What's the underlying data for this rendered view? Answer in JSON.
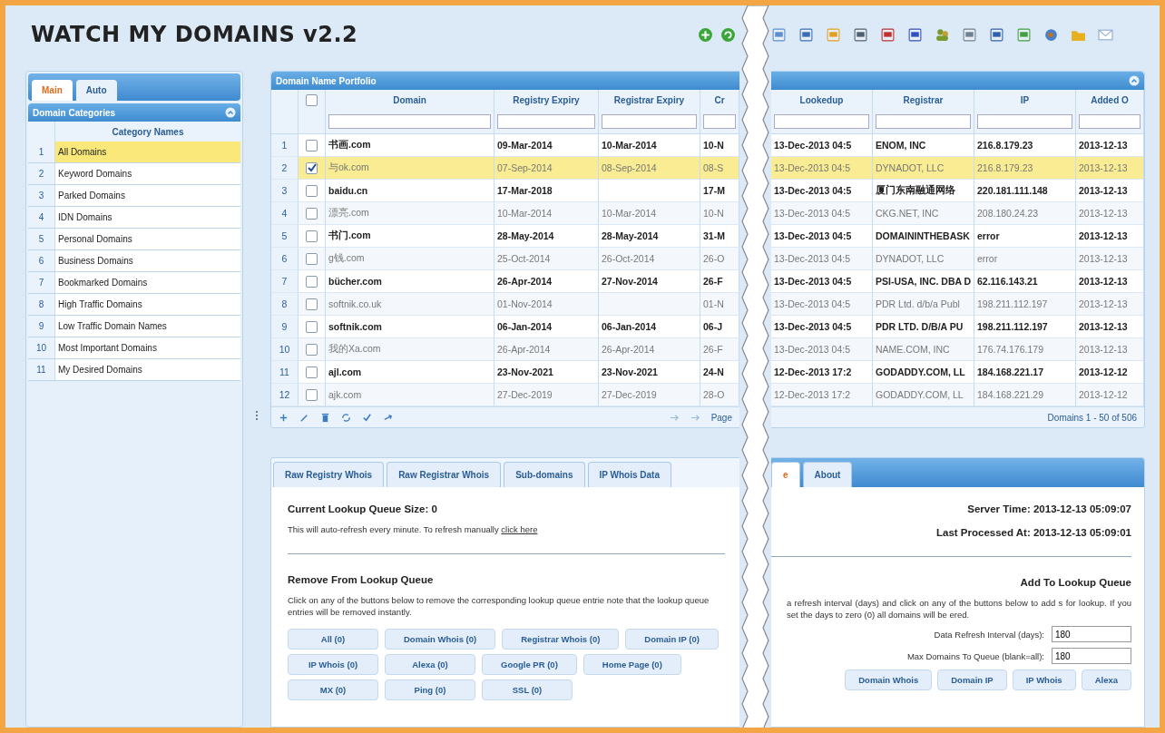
{
  "header": {
    "title": "WATCH MY DOMAINS v2.2"
  },
  "sidebar": {
    "tabs": [
      {
        "label": "Main",
        "selected": true
      },
      {
        "label": "Auto",
        "selected": false
      }
    ],
    "panel_title": "Domain Categories",
    "column": "Category Names",
    "items": [
      {
        "number": "1",
        "label": "All Domains",
        "selected": true
      },
      {
        "number": "2",
        "label": "Keyword Domains",
        "selected": false
      },
      {
        "number": "3",
        "label": "Parked Domains",
        "selected": false
      },
      {
        "number": "4",
        "label": "IDN Domains",
        "selected": false
      },
      {
        "number": "5",
        "label": "Personal Domains",
        "selected": false
      },
      {
        "number": "6",
        "label": "Business Domains",
        "selected": false
      },
      {
        "number": "7",
        "label": "Bookmarked Domains",
        "selected": false
      },
      {
        "number": "8",
        "label": "High Traffic Domains",
        "selected": false
      },
      {
        "number": "9",
        "label": "Low Traffic Domain Names",
        "selected": false
      },
      {
        "number": "10",
        "label": "Most Important Domains",
        "selected": false
      },
      {
        "number": "11",
        "label": "My Desired Domains",
        "selected": false
      }
    ]
  },
  "portfolio": {
    "title": "Domain Name Portfolio",
    "select_all_checked": false,
    "columns": [
      "Domain",
      "Registry Expiry",
      "Registrar Expiry",
      "Cr",
      "Lookedup",
      "Registrar",
      "IP",
      "Added O"
    ],
    "rows": [
      {
        "number": "1",
        "checked": false,
        "selected": false,
        "bold": true,
        "domain": "书画.com",
        "registry_expiry": "09-Mar-2014",
        "registrar_expiry": "10-Mar-2014",
        "column_4": "10-N",
        "lookedup": "13-Dec-2013 04:5",
        "registrar": "ENOM, INC",
        "ip": "216.8.179.23",
        "added": "2013-12-13"
      },
      {
        "number": "2",
        "checked": true,
        "selected": true,
        "bold": false,
        "domain": "与ok.com",
        "registry_expiry": "07-Sep-2014",
        "registrar_expiry": "08-Sep-2014",
        "column_4": "08-S",
        "lookedup": "13-Dec-2013 04:5",
        "registrar": "DYNADOT, LLC",
        "ip": "216.8.179.23",
        "added": "2013-12-13"
      },
      {
        "number": "3",
        "checked": false,
        "selected": false,
        "bold": true,
        "domain": "baidu.cn",
        "registry_expiry": "17-Mar-2018",
        "column_4": "17-M",
        "lookedup": "13-Dec-2013 04:5",
        "registrar": "厦门东南融通网络",
        "ip": "220.181.111.148",
        "added": "2013-12-13"
      },
      {
        "number": "4",
        "checked": false,
        "selected": false,
        "bold": false,
        "domain": "漂亮.com",
        "registry_expiry": "10-Mar-2014",
        "registrar_expiry": "10-Mar-2014",
        "column_4": "10-N",
        "lookedup": "13-Dec-2013 04:5",
        "registrar": "CKG.NET, INC",
        "ip": "208.180.24.23",
        "added": "2013-12-13"
      },
      {
        "number": "5",
        "checked": false,
        "selected": false,
        "bold": true,
        "domain": "书门.com",
        "registry_expiry": "28-May-2014",
        "registrar_expiry": "28-May-2014",
        "column_4": "31-M",
        "lookedup": "13-Dec-2013 04:5",
        "registrar": "DOMAININTHEBASK",
        "ip": "error",
        "added": "2013-12-13"
      },
      {
        "number": "6",
        "checked": false,
        "selected": false,
        "bold": false,
        "domain": "g钱.com",
        "registry_expiry": "25-Oct-2014",
        "registrar_expiry": "26-Oct-2014",
        "column_4": "26-O",
        "lookedup": "13-Dec-2013 04:5",
        "registrar": "DYNADOT, LLC",
        "ip": "error",
        "added": "2013-12-13"
      },
      {
        "number": "7",
        "checked": false,
        "selected": false,
        "bold": true,
        "domain": "bücher.com",
        "registry_expiry": "26-Apr-2014",
        "registrar_expiry": "27-Nov-2014",
        "column_4": "26-F",
        "lookedup": "13-Dec-2013 04:5",
        "registrar": "PSI-USA, INC. DBA D",
        "ip": "62.116.143.21",
        "added": "2013-12-13"
      },
      {
        "number": "8",
        "checked": false,
        "selected": false,
        "bold": false,
        "domain": "softnik.co.uk",
        "registry_expiry": "01-Nov-2014",
        "column_4": "01-N",
        "lookedup": "13-Dec-2013 04:5",
        "registrar": "PDR Ltd. d/b/a Publ",
        "ip": "198.211.112.197",
        "added": "2013-12-13"
      },
      {
        "number": "9",
        "checked": false,
        "selected": false,
        "bold": true,
        "domain": "softnik.com",
        "registry_expiry": "06-Jan-2014",
        "registrar_expiry": "06-Jan-2014",
        "column_4": "06-J",
        "lookedup": "13-Dec-2013 04:5",
        "registrar": "PDR LTD. D/B/A PU",
        "ip": "198.211.112.197",
        "added": "2013-12-13"
      },
      {
        "number": "10",
        "checked": false,
        "selected": false,
        "bold": false,
        "domain": "我的Xa.com",
        "registry_expiry": "26-Apr-2014",
        "registrar_expiry": "26-Apr-2014",
        "column_4": "26-F",
        "lookedup": "13-Dec-2013 04:5",
        "registrar": "NAME.COM, INC",
        "ip": "176.74.176.179",
        "added": "2013-12-13"
      },
      {
        "number": "11",
        "checked": false,
        "selected": false,
        "bold": true,
        "domain": "ajl.com",
        "registry_expiry": "23-Nov-2021",
        "registrar_expiry": "23-Nov-2021",
        "column_4": "24-N",
        "lookedup": "12-Dec-2013 17:2",
        "registrar": "GODADDY.COM, LL",
        "ip": "184.168.221.17",
        "added": "2013-12-12"
      },
      {
        "number": "12",
        "checked": false,
        "selected": false,
        "bold": false,
        "domain": "ajk.com",
        "registry_expiry": "27-Dec-2019",
        "registrar_expiry": "27-Dec-2019",
        "column_4": "28-O",
        "lookedup": "12-Dec-2013 17:2",
        "registrar": "GODADDY.COM, LL",
        "ip": "184.168.221.29",
        "added": "2013-12-12"
      }
    ],
    "pager": "Page",
    "record_info": "Domains 1 - 50 of 506"
  },
  "details": {
    "tabs_left": [
      {
        "label": "Raw Registry Whois",
        "selected": false
      },
      {
        "label": "Raw Registrar Whois",
        "selected": false
      },
      {
        "label": "Sub-domains",
        "selected": false
      },
      {
        "label": "IP Whois Data",
        "selected": false
      }
    ],
    "tabs_right": [
      {
        "label": "e",
        "selected": true
      },
      {
        "label": "About",
        "selected": false
      }
    ],
    "queue_size": "Current Lookup Queue Size: 0",
    "refresh_note": "This will auto-refresh every minute. To refresh manually ",
    "refresh_link": "click here",
    "server_time": "Server Time: 2013-12-13 05:09:07",
    "last_processed": "Last Processed At: 2013-12-13 05:09:01",
    "remove_heading": "Remove From Lookup Queue",
    "remove_note": "Click on any of the buttons below to remove the corresponding lookup queue entrie note that the lookup queue entries will be removed instantly.",
    "remove_buttons": [
      "All (0)",
      "Domain Whois (0)",
      "Registrar Whois (0)",
      "Domain IP (0)",
      "IP Whois (0)",
      "Alexa (0)",
      "Google PR (0)",
      "Home Page (0)",
      "MX (0)",
      "Ping (0)",
      "SSL (0)"
    ],
    "add_heading": "Add To Lookup Queue",
    "add_note": "a refresh interval (days) and click on any of the buttons below to add s for lookup. If you set the days to zero (0) all domains will be ered.",
    "fields": [
      {
        "label": "Data Refresh Interval (days):",
        "value": "180"
      },
      {
        "label": "Max Domains To Queue (blank=all):",
        "value": "180"
      }
    ],
    "add_buttons": [
      "Domain Whois",
      "Domain IP",
      "IP Whois",
      "Alexa"
    ]
  }
}
